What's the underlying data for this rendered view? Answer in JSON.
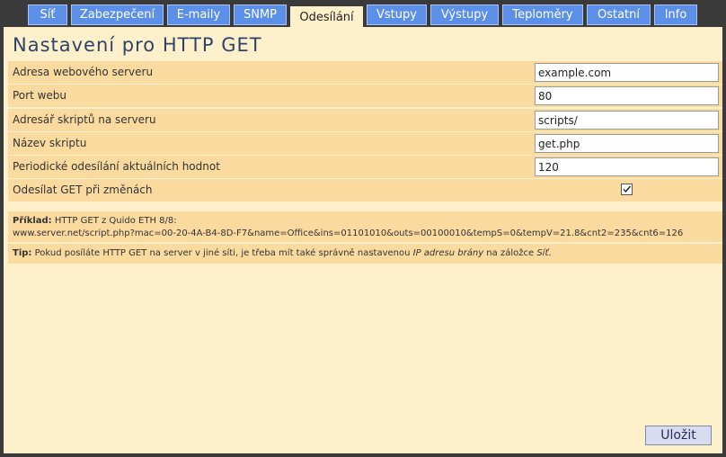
{
  "tabs": [
    {
      "label": "Síť"
    },
    {
      "label": "Zabezpečení"
    },
    {
      "label": "E-maily"
    },
    {
      "label": "SNMP"
    },
    {
      "label": "Odesílání"
    },
    {
      "label": "Vstupy"
    },
    {
      "label": "Výstupy"
    },
    {
      "label": "Teploměry"
    },
    {
      "label": "Ostatní"
    },
    {
      "label": "Info"
    }
  ],
  "active_tab": "Odesílání",
  "page": {
    "title": "Nastavení pro HTTP GET"
  },
  "form": {
    "server_address": {
      "label": "Adresa webového serveru",
      "value": "example.com"
    },
    "web_port": {
      "label": "Port webu",
      "value": "80"
    },
    "scripts_dir": {
      "label": "Adresář skriptů na serveru",
      "value": "scripts/"
    },
    "script_name": {
      "label": "Název skriptu",
      "value": "get.php"
    },
    "periodic_send": {
      "label": "Periodické odesílání aktuálních hodnot",
      "value": "120"
    },
    "send_on_change": {
      "label": "Odesílat GET při změnách",
      "checked": true
    }
  },
  "example": {
    "heading": "Příklad:",
    "text": "HTTP GET z Quido ETH 8/8:",
    "url": "www.server.net/script.php?mac=00-20-4A-B4-8D-F7&name=Office&ins=01101010&outs=00100010&tempS=0&tempV=21.8&cnt2=235&cnt6=126"
  },
  "tip": {
    "heading": "Tip:",
    "text_before": "Pokud posíláte HTTP GET na server v jiné síti, je třeba mít také správně nastavenou",
    "emphasis": "IP adresu brány",
    "text_middle": "na záložce",
    "tab_ref": "Síť",
    "text_end": "."
  },
  "actions": {
    "save_label": "Uložit"
  },
  "colors": {
    "tab_background": "#5b8fe8",
    "panel_background": "#fff0cc",
    "row_background": "#fbdaa0",
    "title_color": "#2d4468"
  }
}
